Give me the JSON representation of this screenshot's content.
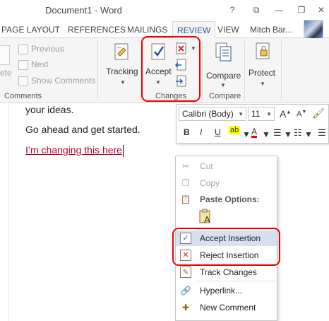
{
  "window": {
    "title": "Document1 - Word",
    "help": "?",
    "restore": "⧉",
    "minimize": "—",
    "close": "✕"
  },
  "tabs": [
    "PAGE LAYOUT",
    "REFERENCES",
    "MAILINGS",
    "REVIEW",
    "VIEW"
  ],
  "user": "Mitch Bar...",
  "ribbon": {
    "comments": {
      "delete_label": "ete",
      "previous_label": "Previous",
      "next_label": "Next",
      "show_comments_label": "Show Comments",
      "group_label": "Comments"
    },
    "tracking_label": "Tracking",
    "accept_label": "Accept",
    "changes_group_label": "Changes",
    "compare_label": "Compare",
    "compare_group_label": "Compare",
    "protect_label": "Protect"
  },
  "document": {
    "line1": "your ideas.",
    "line2": "Go ahead and get started.",
    "line3": "I’m changing this here"
  },
  "mini_toolbar": {
    "font": "Calibri (Body)",
    "size": "11",
    "grow": "A",
    "shrink": "A",
    "bold": "B",
    "italic": "I",
    "underline": "U",
    "font_color": "A"
  },
  "context_menu": {
    "cut": "Cut",
    "copy": "Copy",
    "paste_options": "Paste Options:",
    "paste_glyph": "A",
    "accept_insertion": "Accept Insertion",
    "reject_insertion": "Reject Insertion",
    "track_changes": "Track Changes",
    "hyperlink": "Hyperlink...",
    "new_comment": "New Comment"
  },
  "colors": {
    "accent": "#2b579a",
    "tracked_text": "#b5002d",
    "highlight_box": "#e00000",
    "menu_hover": "#d5e1f2"
  }
}
